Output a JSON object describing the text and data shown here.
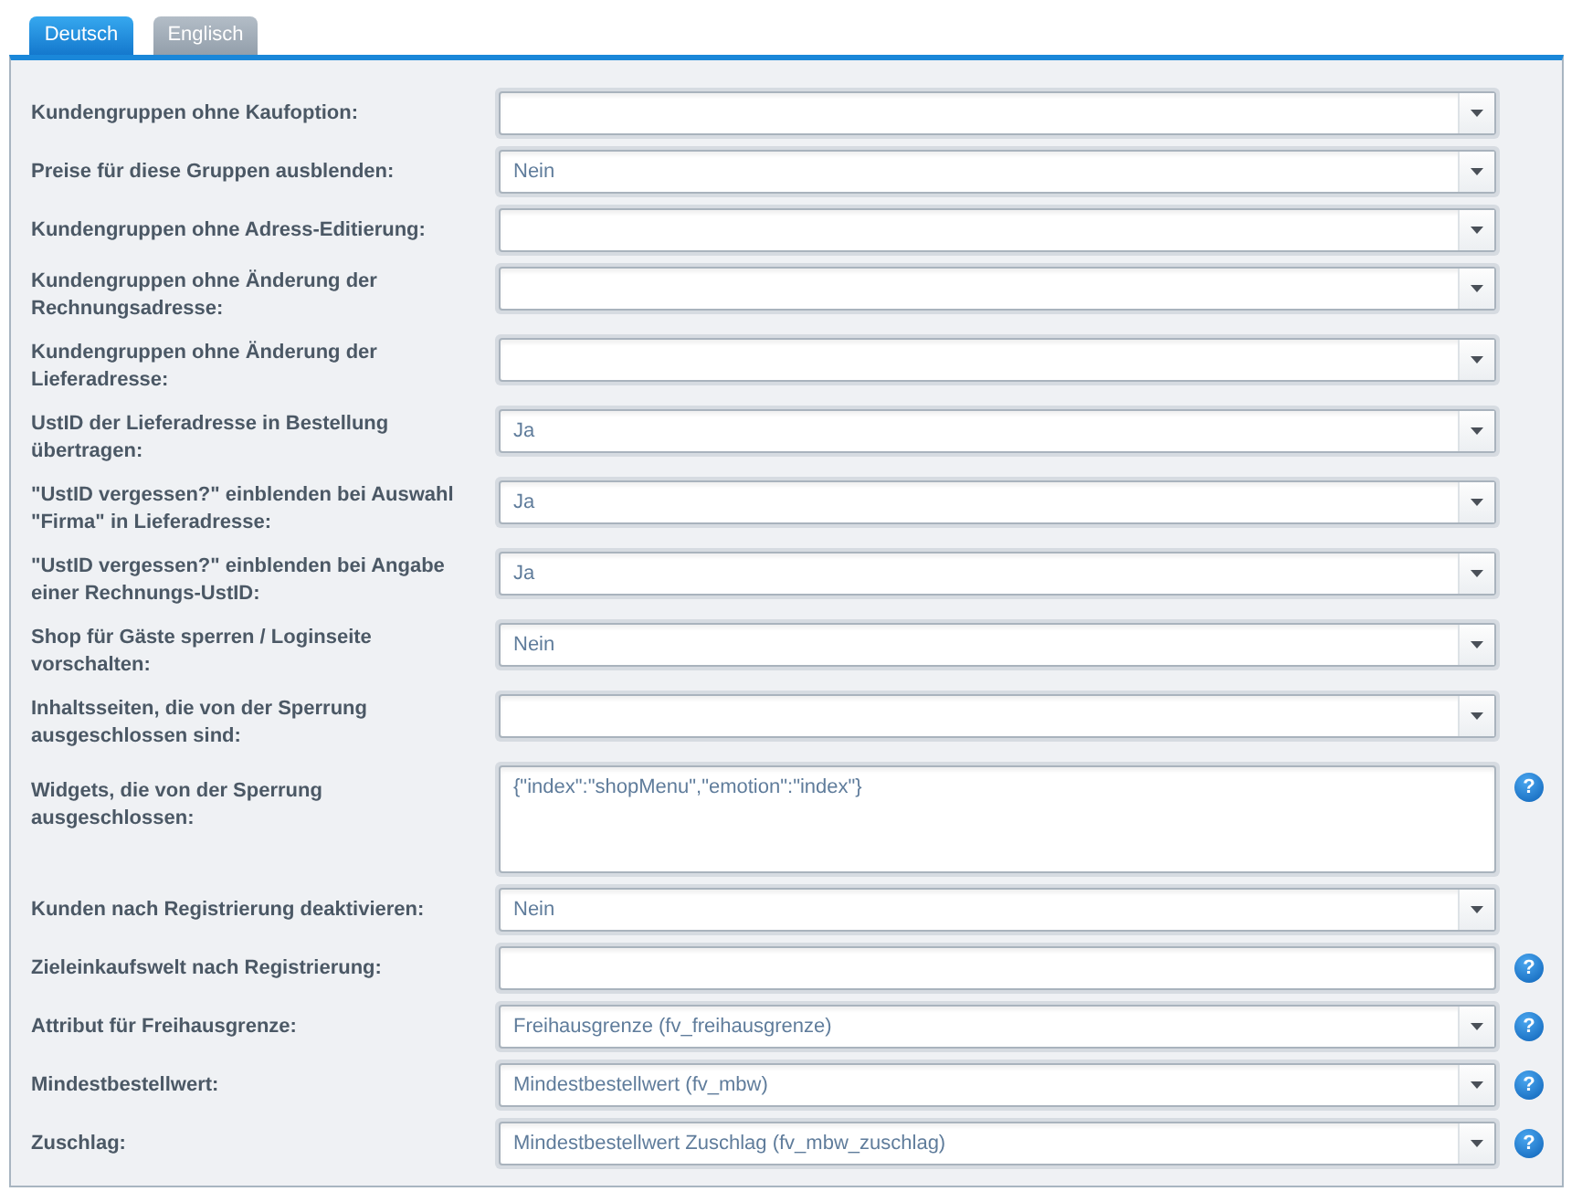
{
  "tabs": [
    {
      "label": "Deutsch",
      "selected": true
    },
    {
      "label": "Englisch",
      "selected": false
    }
  ],
  "form": {
    "rows": [
      {
        "label": "Kundengruppen ohne Kaufoption:",
        "kind": "dropdown"
      },
      {
        "label": "Preise für diese Gruppen ausblenden:",
        "kind": "dropdown",
        "value": "Nein"
      },
      {
        "label": "Kundengruppen ohne Adress-Editierung:",
        "kind": "dropdown"
      },
      {
        "label": "Kundengruppen ohne Änderung der Rechnungsadresse:",
        "kind": "dropdown"
      },
      {
        "label": "Kundengruppen ohne Änderung der Lieferadresse:",
        "kind": "dropdown"
      },
      {
        "label": "UstID der Lieferadresse in Bestellung übertragen:",
        "kind": "dropdown",
        "value": "Ja"
      },
      {
        "label": "\"UstID vergessen?\" einblenden bei Auswahl \"Firma\" in Lieferadresse:",
        "kind": "dropdown",
        "value": "Ja"
      },
      {
        "label": "\"UstID vergessen?\" einblenden bei Angabe einer Rechnungs-UstID:",
        "kind": "dropdown",
        "value": "Ja"
      },
      {
        "label": "Shop für Gäste sperren / Loginseite vorschalten:",
        "kind": "dropdown",
        "value": "Nein"
      },
      {
        "label": "Inhaltsseiten, die von der Sperrung ausgeschlossen sind:",
        "kind": "dropdown"
      },
      {
        "label": "Widgets, die von der Sperrung ausgeschlossen:",
        "kind": "textarea",
        "value": "{\"index\":\"shopMenu\",\"emotion\":\"index\"}",
        "help": "?"
      },
      {
        "label": "Kunden nach Registrierung deaktivieren:",
        "kind": "dropdown",
        "value": "Nein"
      },
      {
        "label": "Zieleinkaufswelt nach Registrierung:",
        "kind": "text",
        "help": "?"
      },
      {
        "label": "Attribut für Freihausgrenze:",
        "kind": "dropdown",
        "value": "Freihausgrenze (fv_freihausgrenze)",
        "help": "?"
      },
      {
        "label": "Mindestbestellwert:",
        "kind": "dropdown",
        "value": "Mindestbestellwert (fv_mbw)",
        "help": "?"
      },
      {
        "label": "Zuschlag:",
        "kind": "dropdown",
        "value": "Mindestbestellwert Zuschlag (fv_mbw_zuschlag)",
        "help": "?"
      }
    ]
  }
}
